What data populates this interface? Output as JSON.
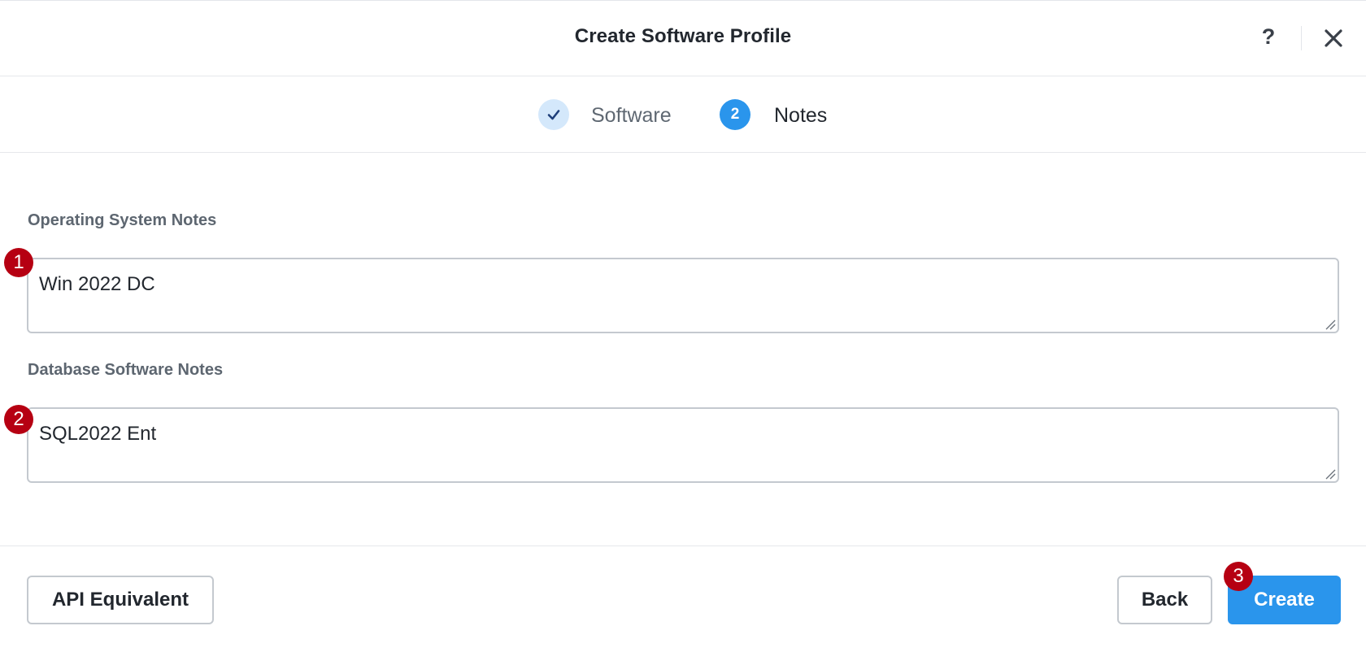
{
  "dialog": {
    "title": "Create Software Profile",
    "help_label": "?"
  },
  "stepper": {
    "steps": [
      {
        "label": "Software",
        "state": "completed",
        "icon": "check-icon"
      },
      {
        "label": "Notes",
        "number": "2",
        "state": "active"
      }
    ]
  },
  "form": {
    "os_notes": {
      "label": "Operating System Notes",
      "value": "Win 2022 DC"
    },
    "db_notes": {
      "label": "Database Software Notes",
      "value": "SQL2022 Ent"
    }
  },
  "annotations": {
    "badge_1": "1",
    "badge_2": "2",
    "badge_3": "3",
    "color": "#b60012"
  },
  "footer": {
    "api_label": "API Equivalent",
    "back_label": "Back",
    "create_label": "Create"
  },
  "colors": {
    "primary": "#2a95ec",
    "completed_step_bg": "#d4e8fb",
    "border": "#c4c9cf"
  }
}
